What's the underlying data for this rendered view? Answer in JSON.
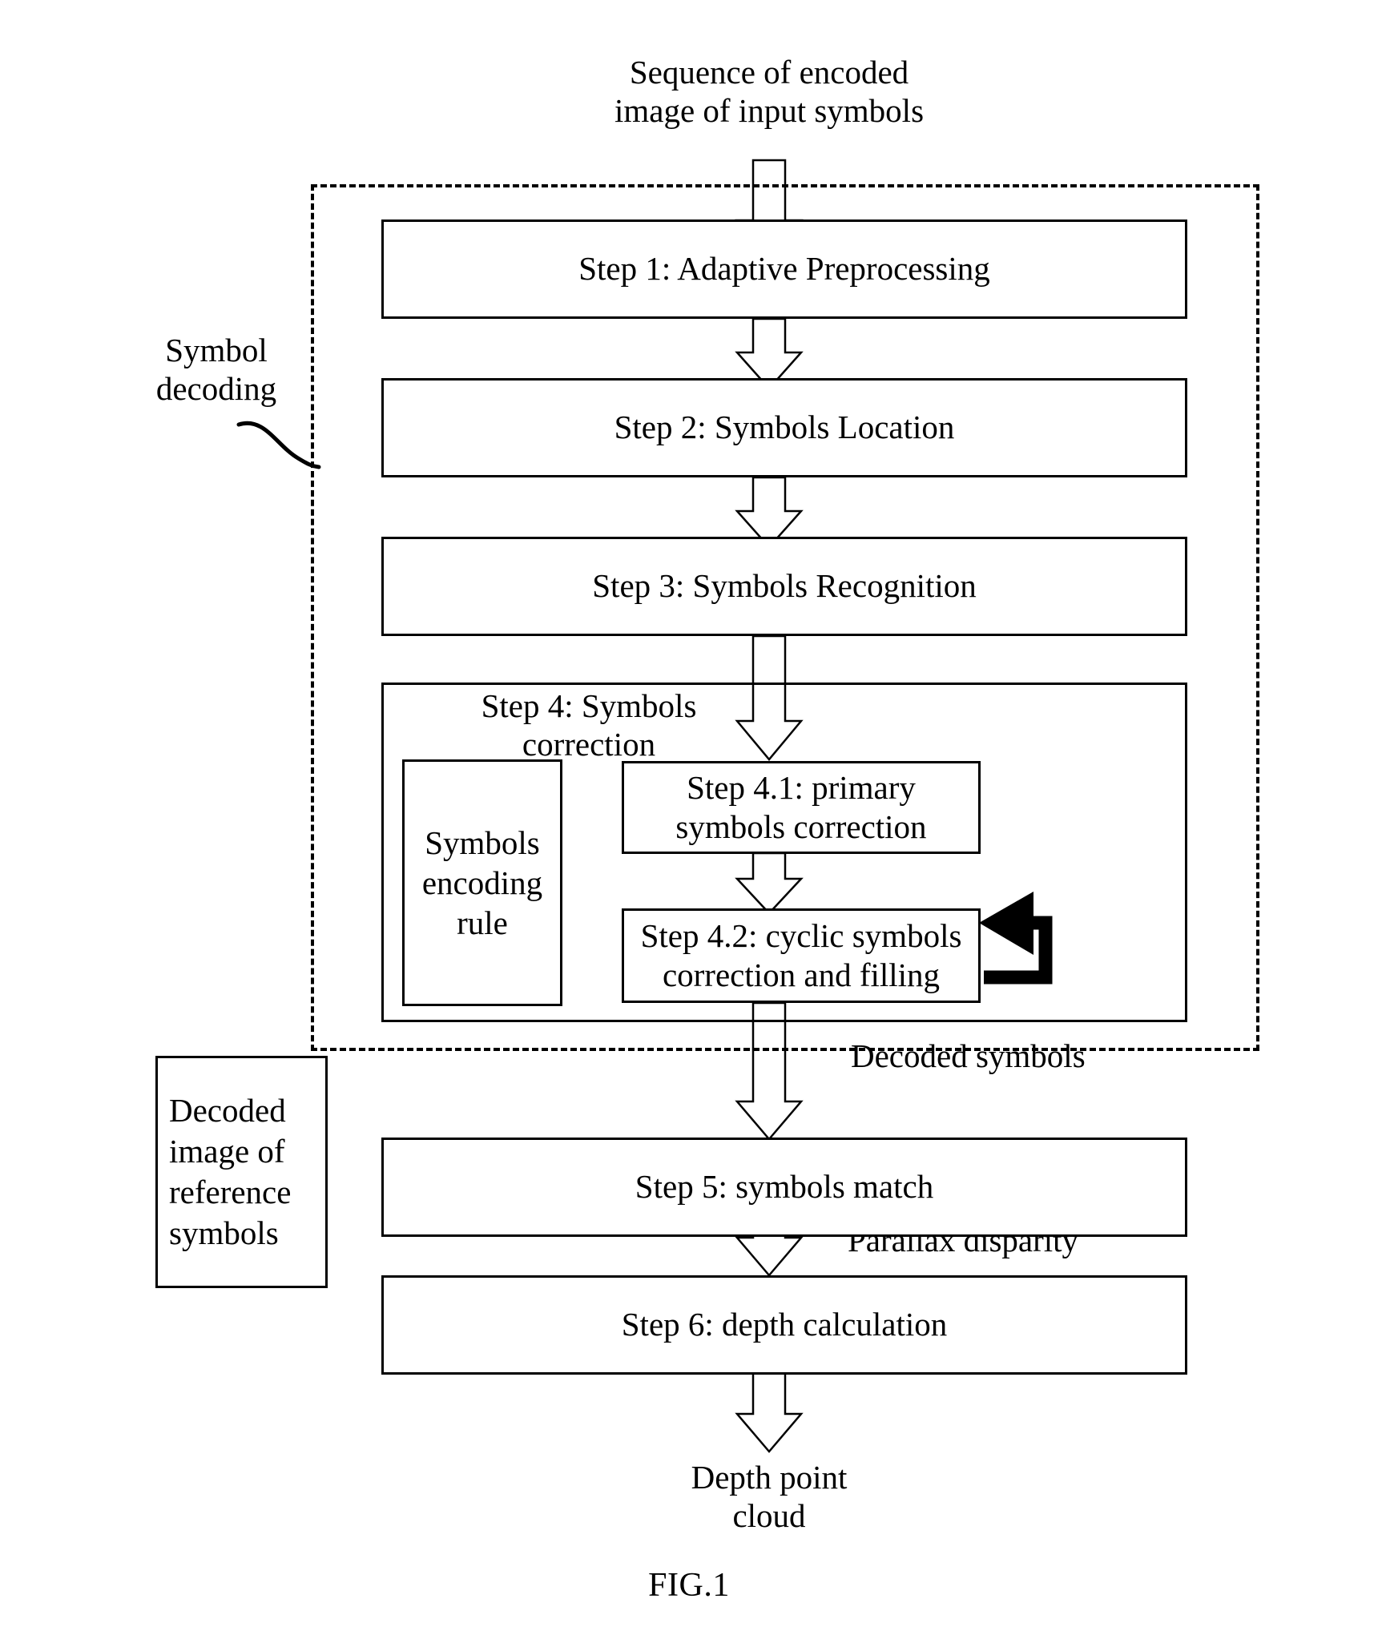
{
  "figure": {
    "caption": "FIG.1",
    "input_label": "Sequence of encoded\nimage of input symbols",
    "output_label": "Depth point\ncloud",
    "region_label": "Symbol decoding",
    "intermediate_labels": {
      "decoded_symbols": "Decoded symbols",
      "parallax_disparity": "Parallax disparity"
    }
  },
  "steps": {
    "step1": "Step 1: Adaptive Preprocessing",
    "step2": "Step 2: Symbols Location",
    "step3": "Step 3: Symbols Recognition",
    "step4_title": "Step 4: Symbols\ncorrection",
    "step4_1": "Step 4.1: primary\nsymbols correction",
    "step4_2": "Step 4.2: cyclic symbols\ncorrection and filling",
    "step5": "Step 5: symbols match",
    "step6": "Step 6: depth calculation"
  },
  "side_boxes": {
    "encoding_rule": "Symbols\nencoding\nrule",
    "reference_symbols": "Decoded\nimage of\nreference\nsymbols"
  },
  "colors": {
    "stroke": "#000000",
    "background": "#ffffff",
    "arrow_fill": "#ffffff",
    "feedback_arrow": "#000000"
  },
  "icons": {
    "block_arrow_down": "block-arrow-down-icon",
    "feedback_loop": "feedback-loop-arrow-icon",
    "leader_line": "leader-line-icon"
  }
}
